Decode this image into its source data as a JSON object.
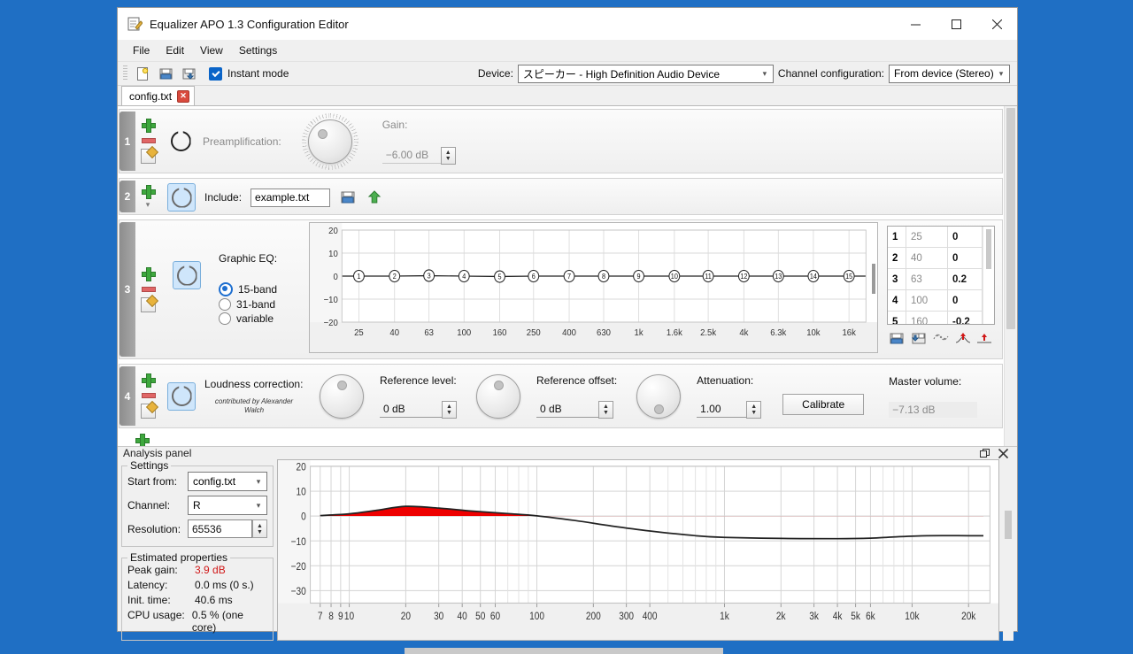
{
  "window": {
    "title": "Equalizer APO 1.3 Configuration Editor",
    "icon": "editor-icon",
    "minimize": "—",
    "maximize": "☐",
    "close": "✕"
  },
  "menu": {
    "items": [
      "File",
      "Edit",
      "View",
      "Settings"
    ]
  },
  "toolbar": {
    "new_label": "new-file-icon",
    "open_label": "open-file-icon",
    "save_label": "save-file-icon",
    "instant_mode_label": "Instant mode",
    "instant_mode_checked": true,
    "device_label": "Device:",
    "device_value": "スピーカー - High Definition Audio Device",
    "channel_config_label": "Channel configuration:",
    "channel_config_value": "From device (Stereo)"
  },
  "tabs": [
    {
      "label": "config.txt",
      "close": "✕",
      "active": true
    }
  ],
  "filters": [
    {
      "index": "1",
      "type": "preamplification",
      "label": "Preamplification:",
      "gain_label": "Gain:",
      "gain_value": "−6.00 dB",
      "enabled_icon": "power-icon"
    },
    {
      "index": "2",
      "type": "include",
      "label": "Include:",
      "file_value": "example.txt",
      "browse_icon": "open-file-icon",
      "open_icon": "go-up-icon"
    },
    {
      "index": "3",
      "type": "graphic-eq",
      "label": "Graphic EQ:",
      "bands": [
        {
          "option": "15-band",
          "selected": true
        },
        {
          "option": "31-band",
          "selected": false
        },
        {
          "option": "variable",
          "selected": false
        }
      ],
      "table_rows": [
        {
          "idx": "1",
          "freq": "25",
          "gain": "0"
        },
        {
          "idx": "2",
          "freq": "40",
          "gain": "0"
        },
        {
          "idx": "3",
          "freq": "63",
          "gain": "0.2"
        },
        {
          "idx": "4",
          "freq": "100",
          "gain": "0"
        },
        {
          "idx": "5",
          "freq": "160",
          "gain": "-0.2"
        }
      ],
      "table_tools": [
        "load-icon",
        "save-icon",
        "smooth-icon",
        "normalize-icon",
        "flatten-icon"
      ]
    },
    {
      "index": "4",
      "type": "loudness-correction",
      "label": "Loudness correction:",
      "credit": "contributed by\nAlexander Walch",
      "reference_level_label": "Reference level:",
      "reference_level_value": "0 dB",
      "reference_offset_label": "Reference offset:",
      "reference_offset_value": "0 dB",
      "attenuation_label": "Attenuation:",
      "attenuation_value": "1.00",
      "calibrate_label": "Calibrate",
      "master_volume_label": "Master volume:",
      "master_volume_value": "−7.13 dB"
    }
  ],
  "add_filter_label": "add-filter-icon",
  "analysis": {
    "title": "Analysis panel",
    "float_icon": "float-icon",
    "close_icon": "close-icon",
    "settings_title": "Settings",
    "start_from_label": "Start from:",
    "start_from_value": "config.txt",
    "channel_label": "Channel:",
    "channel_value": "R",
    "resolution_label": "Resolution:",
    "resolution_value": "65536",
    "properties_title": "Estimated properties",
    "properties": [
      {
        "label": "Peak gain:",
        "value": "3.9 dB",
        "red": true
      },
      {
        "label": "Latency:",
        "value": "0.0 ms (0 s.)",
        "red": false
      },
      {
        "label": "Init. time:",
        "value": "40.6 ms",
        "red": false
      },
      {
        "label": "CPU usage:",
        "value": "0.5 % (one core)",
        "red": false
      }
    ]
  },
  "chart_data": [
    {
      "type": "line",
      "name": "graphic-eq-curve",
      "title": "",
      "xlabel": "",
      "ylabel": "",
      "xscale": "log",
      "grid": true,
      "ylim": [
        -20,
        20
      ],
      "yticks": [
        20,
        10,
        0,
        -10,
        -20
      ],
      "xticks": [
        "25",
        "40",
        "63",
        "100",
        "160",
        "250",
        "400",
        "630",
        "1k",
        "1.6k",
        "2.5k",
        "4k",
        "6.3k",
        "10k",
        "16k"
      ],
      "x": [
        25,
        40,
        63,
        100,
        160,
        250,
        400,
        630,
        1000,
        1600,
        2500,
        4000,
        6300,
        10000,
        16000
      ],
      "values": [
        0,
        0,
        0.2,
        0,
        -0.2,
        0,
        0,
        0,
        0,
        0,
        0,
        0,
        0,
        0,
        0
      ],
      "point_labels": [
        "1",
        "2",
        "3",
        "4",
        "5",
        "6",
        "7",
        "8",
        "9",
        "10",
        "11",
        "12",
        "13",
        "14",
        "15"
      ]
    },
    {
      "type": "area",
      "name": "analysis-response-curve",
      "title": "",
      "xlabel": "",
      "ylabel": "",
      "xscale": "log",
      "grid": true,
      "ylim": [
        -35,
        20
      ],
      "yticks": [
        20,
        10,
        0,
        -10,
        -20,
        -30
      ],
      "xticks": [
        "7",
        "8",
        "9",
        "10",
        "20",
        "30",
        "40",
        "50",
        "60",
        "100",
        "200",
        "300",
        "400",
        "1k",
        "2k",
        "3k",
        "4k",
        "5k",
        "6k",
        "10k",
        "20k"
      ],
      "fill_color": "#ee0000",
      "line_color": "#222222",
      "x": [
        7,
        10,
        14,
        20,
        30,
        45,
        70,
        100,
        160,
        250,
        400,
        700,
        1000,
        2000,
        4000,
        6000,
        8000,
        12000,
        20000,
        24000
      ],
      "values": [
        0.2,
        0.9,
        2.3,
        3.9,
        3.2,
        2.0,
        1.0,
        0.1,
        -1.8,
        -4.0,
        -6.0,
        -7.9,
        -8.6,
        -9.0,
        -9.1,
        -8.9,
        -8.4,
        -7.9,
        -7.9,
        -7.9
      ]
    }
  ]
}
